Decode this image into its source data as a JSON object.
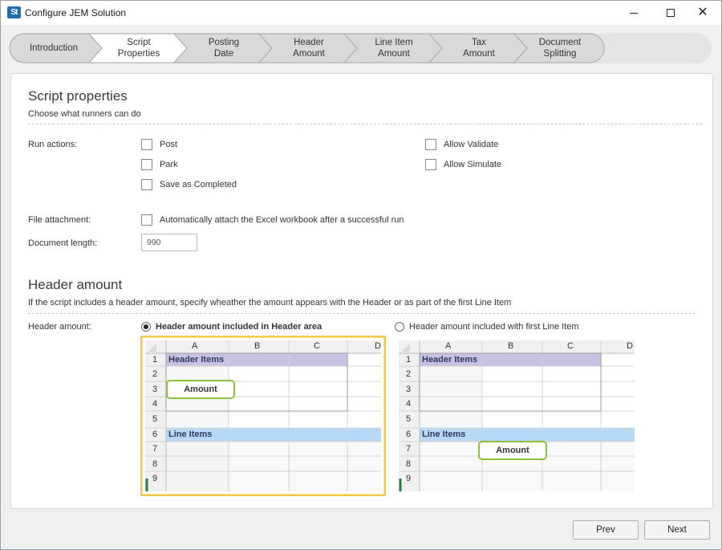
{
  "window": {
    "title": "Configure JEM Solution",
    "icon_text": "St"
  },
  "steps": [
    {
      "label": "Introduction",
      "state": "done"
    },
    {
      "label": "Script\nProperties",
      "state": "current"
    },
    {
      "label": "Posting\nDate",
      "state": "todo"
    },
    {
      "label": "Header\nAmount",
      "state": "todo"
    },
    {
      "label": "Line Item\nAmount",
      "state": "todo"
    },
    {
      "label": "Tax\nAmount",
      "state": "todo"
    },
    {
      "label": "Document\nSplitting",
      "state": "todo"
    }
  ],
  "script_properties": {
    "title": "Script properties",
    "subtitle": "Choose what runners can do",
    "run_actions_label": "Run actions:",
    "post": "Post",
    "park": "Park",
    "save_completed": "Save as Completed",
    "allow_validate": "Allow Validate",
    "allow_simulate": "Allow Simulate",
    "file_attachment_label": "File attachment:",
    "auto_attach": "Automatically attach the Excel workbook after a successful run",
    "document_length_label": "Document length:",
    "document_length_value": "990"
  },
  "header_amount": {
    "title": "Header amount",
    "subtitle": "If the script includes a header amount, specify wheather the amount appears with the Header or as part of the first Line Item",
    "field_label": "Header amount:",
    "option_header": "Header amount included in Header area",
    "option_line": "Header amount included with first Line Item",
    "selected": "header"
  },
  "sheet": {
    "columns": [
      "A",
      "B",
      "C",
      "D"
    ],
    "rows": [
      "1",
      "2",
      "3",
      "4",
      "5",
      "6",
      "7",
      "8",
      "9"
    ],
    "header_items": "Header Items",
    "line_items": "Line Items",
    "amount": "Amount"
  },
  "colors": {
    "header_band": "#c9c1e3",
    "line_band": "#b7d9f5",
    "amount_border": "#8ac23a",
    "selected_frame": "#f0c84a",
    "step_current": "#ffffff",
    "step_other": "#d9d9d9"
  },
  "buttons": {
    "prev": "Prev",
    "next": "Next"
  }
}
